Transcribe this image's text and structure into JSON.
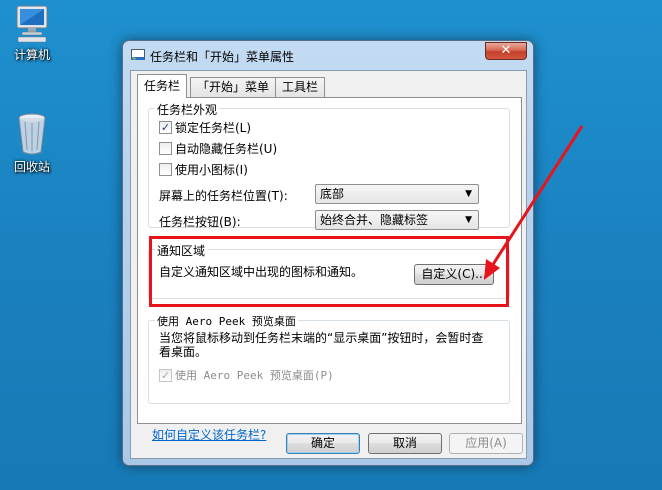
{
  "desktop": {
    "icons": [
      {
        "label": "计算机",
        "icon": "computer-icon"
      },
      {
        "label": "回收站",
        "icon": "recycle-bin-icon"
      }
    ]
  },
  "dialog": {
    "title": "任务栏和「开始」菜单属性",
    "close_label": "✕",
    "tabs": [
      {
        "label": "任务栏",
        "active": true
      },
      {
        "label": "「开始」菜单",
        "active": false
      },
      {
        "label": "工具栏",
        "active": false
      }
    ],
    "appearance": {
      "title": "任务栏外观",
      "lock_taskbar": {
        "label": "锁定任务栏(L)",
        "checked": true
      },
      "auto_hide": {
        "label": "自动隐藏任务栏(U)",
        "checked": false
      },
      "small_icons": {
        "label": "使用小图标(I)",
        "checked": false
      },
      "location_label": "屏幕上的任务栏位置(T):",
      "location_value": "底部",
      "buttons_label": "任务栏按钮(B):",
      "buttons_value": "始终合并、隐藏标签"
    },
    "notification": {
      "title": "通知区域",
      "description": "自定义通知区域中出现的图标和通知。",
      "customize_label": "自定义(C)..."
    },
    "aero_peek": {
      "title": "使用 Aero Peek 预览桌面",
      "description": "当您将鼠标移动到任务栏末端的“显示桌面”按钮时，会暂时查看桌面。",
      "checkbox": {
        "label": "使用 Aero Peek 预览桌面(P)",
        "checked": true,
        "disabled": true
      }
    },
    "help_link": "如何自定义该任务栏?",
    "ok_label": "确定",
    "cancel_label": "取消",
    "apply_label": "应用(A)"
  },
  "colors": {
    "annotation": "#e8141b",
    "link": "#0066cc",
    "desktop": "#1a7fbd"
  }
}
